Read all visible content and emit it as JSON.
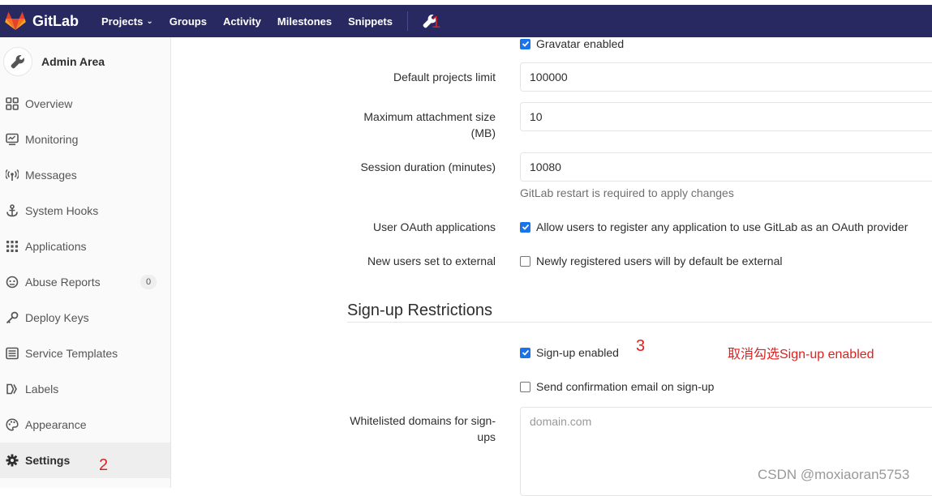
{
  "nav": {
    "brand": "GitLab",
    "items": [
      {
        "label": "Projects",
        "dropdown": true
      },
      {
        "label": "Groups",
        "dropdown": false
      },
      {
        "label": "Activity",
        "dropdown": false
      },
      {
        "label": "Milestones",
        "dropdown": false
      },
      {
        "label": "Snippets",
        "dropdown": false
      }
    ],
    "admin_icon": "wrench-icon"
  },
  "sidebar": {
    "title": "Admin Area",
    "items": [
      {
        "label": "Overview",
        "icon": "overview-grid-icon"
      },
      {
        "label": "Monitoring",
        "icon": "monitor-icon"
      },
      {
        "label": "Messages",
        "icon": "broadcast-icon"
      },
      {
        "label": "System Hooks",
        "icon": "anchor-icon"
      },
      {
        "label": "Applications",
        "icon": "apps-grid-icon"
      },
      {
        "label": "Abuse Reports",
        "icon": "abuse-face-icon",
        "badge": "0"
      },
      {
        "label": "Deploy Keys",
        "icon": "key-icon"
      },
      {
        "label": "Service Templates",
        "icon": "template-icon"
      },
      {
        "label": "Labels",
        "icon": "label-icon"
      },
      {
        "label": "Appearance",
        "icon": "palette-icon"
      },
      {
        "label": "Settings",
        "icon": "gear-icon",
        "active": true
      }
    ]
  },
  "form": {
    "gravatar_label": "Gravatar enabled",
    "projects_limit_label": "Default projects limit",
    "projects_limit_value": "100000",
    "attachment_label_1": "Maximum attachment size",
    "attachment_label_2": "(MB)",
    "attachment_value": "10",
    "session_label": "Session duration (minutes)",
    "session_value": "10080",
    "session_help": "GitLab restart is required to apply changes",
    "oauth_label": "User OAuth applications",
    "oauth_check": "Allow users to register any application to use GitLab as an OAuth provider",
    "external_label": "New users set to external",
    "external_check": "Newly registered users will by default be external"
  },
  "signup": {
    "title": "Sign-up Restrictions",
    "enabled_check": "Sign-up enabled",
    "confirm_check": "Send confirmation email on sign-up",
    "whitelist_label_1": "Whitelisted domains for sign-",
    "whitelist_label_2": "ups",
    "whitelist_placeholder": "domain.com"
  },
  "annotations": {
    "step1": "1",
    "step2": "2",
    "step3": "3",
    "note": "取消勾选Sign-up enabled"
  },
  "watermark": "CSDN @moxiaoran5753",
  "colors": {
    "navbar": "#292961",
    "checkbox": "#1a73e8",
    "annotation": "#e02020"
  }
}
